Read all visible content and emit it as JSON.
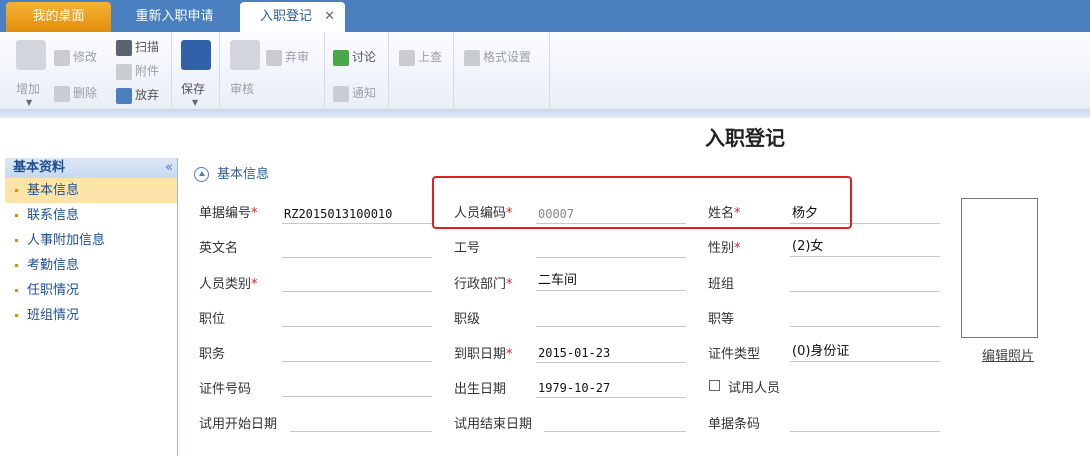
{
  "tabs": [
    {
      "label": "我的桌面"
    },
    {
      "label": "重新入职申请"
    },
    {
      "label": "入职登记",
      "close": "✕"
    }
  ],
  "toolbar": {
    "add": "增加",
    "edit": "修改",
    "delete": "删除",
    "scan": "扫描",
    "attach": "附件",
    "discard": "放弃",
    "save": "保存",
    "review": "审核",
    "abandon": "弃审",
    "discuss": "讨论",
    "notify": "通知",
    "query_up": "上查",
    "format": "格式设置"
  },
  "page_title": "入职登记",
  "sidebar": {
    "header": "基本资料",
    "collapse": "«",
    "items": [
      {
        "label": "基本信息"
      },
      {
        "label": "联系信息"
      },
      {
        "label": "人事附加信息"
      },
      {
        "label": "考勤信息"
      },
      {
        "label": "任职情况"
      },
      {
        "label": "班组情况"
      }
    ]
  },
  "section": {
    "title": "基本信息"
  },
  "form": {
    "doc_no_label": "单据编号",
    "doc_no": "RZ2015013100010",
    "emp_code_label": "人员编码",
    "emp_code_placeholder": "00007",
    "name_label": "姓名",
    "name": "杨夕",
    "eng_name_label": "英文名",
    "job_no_label": "工号",
    "gender_label": "性别",
    "gender": "(2)女",
    "emp_type_label": "人员类别",
    "dept_label": "行政部门",
    "dept": "二车间",
    "team_label": "班组",
    "position_label": "职位",
    "rank_label": "职级",
    "grade_label": "职等",
    "duty_label": "职务",
    "hire_date_label": "到职日期",
    "hire_date": "2015-01-23",
    "id_type_label": "证件类型",
    "id_type": "(0)身份证",
    "id_no_label": "证件号码",
    "birth_label": "出生日期",
    "birth": "1979-10-27",
    "trial_label": "试用人员",
    "trial_start_label": "试用开始日期",
    "trial_end_label": "试用结束日期",
    "barcode_label": "单据条码",
    "required_mark": "*"
  },
  "photo": {
    "edit_label": "编辑照片"
  }
}
